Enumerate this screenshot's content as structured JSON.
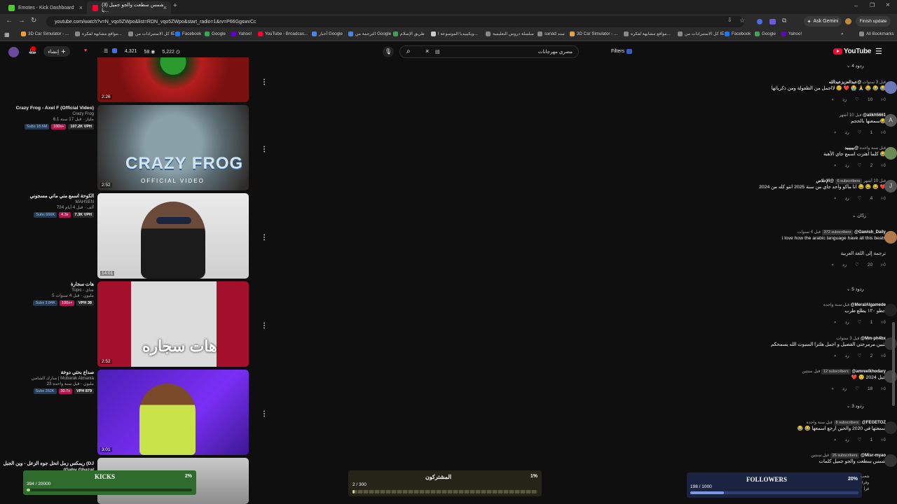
{
  "browser": {
    "tabs": [
      {
        "title": "Emotes - Kick Dashboard",
        "fav": "#52c934"
      },
      {
        "title": "(3) شمس سطعت والجو جميل يا...",
        "fav": "#ff0033"
      }
    ],
    "new_tab": "+",
    "url": "youtube.com/watch?v=N_vqo5ZWpo&list=RDN_vqo5ZWpo&start_radio=1&rv=P66GgswvCc",
    "ask_gemini": "Ask Gemini",
    "finish_update": "Finish update",
    "bookmarks": [
      {
        "label": "3D Car Simulator - ...",
        "c": "#f0a030"
      },
      {
        "label": "مواقع مشابهة لفكرة...",
        "c": "#888"
      },
      {
        "label": "كل الاستيرادات من IE",
        "c": "#888"
      },
      {
        "label": "Facebook",
        "c": "#1877f2"
      },
      {
        "label": "Google",
        "c": "#34a853"
      },
      {
        "label": "Yahoo!",
        "c": "#6001d2"
      },
      {
        "label": "YouTube - Broadcas...",
        "c": "#ff0033"
      },
      {
        "label": "أخبار Google",
        "c": "#4285f4"
      },
      {
        "label": "الترجمة من Google",
        "c": "#4285f4"
      },
      {
        "label": "طريق الإسلام",
        "c": "#3aa655"
      },
      {
        "label": "ويكيبيديا الموسوعة ا...",
        "c": "#ccc"
      },
      {
        "label": "سلسلة دروس التعليمية",
        "c": "#888"
      },
      {
        "label": "sanad سند",
        "c": "#888"
      },
      {
        "label": "3D Car Simulator - ...",
        "c": "#f0a030"
      },
      {
        "label": "مواقع مشابهة لفكرة...",
        "c": "#888"
      },
      {
        "label": "كل الاستيرادات من IE",
        "c": "#888"
      },
      {
        "label": "Facebook",
        "c": "#1877f2"
      },
      {
        "label": "Google",
        "c": "#34a853"
      },
      {
        "label": "Yahoo!",
        "c": "#6001d2"
      }
    ],
    "all_bookmarks": "All Bookmarks"
  },
  "masthead": {
    "create_label": "إنشاء",
    "stats": [
      "4,321",
      "58",
      "5,222"
    ],
    "search_query": "مصري مهرجانات",
    "filters_label": "Filters",
    "logo_text": "YouTube"
  },
  "playlist": [
    {
      "title": "",
      "channel": "",
      "meta": "",
      "duration": "2:26",
      "badges": [],
      "thumb": "v0"
    },
    {
      "title": "Crazy Frog - Axel F (Official Video)",
      "channel": "Crazy Frog",
      "meta": "6.1 مليار · قبل 17 سنة",
      "duration": "2:52",
      "badges": [
        "Subs 18.6M",
        "100x+",
        "107.2K VPH"
      ],
      "thumb": "v1"
    },
    {
      "title": "الكوحة اسمع مني ماني مسجوني",
      "channel": "MAHSEN",
      "meta": "724 ألف · قبل 4 أيام",
      "duration": "14:01",
      "badges": [
        "Subs 666K",
        "4.3x",
        "7.3K VPH"
      ],
      "thumb": "v2"
    },
    {
      "title": "هات سجارة",
      "channel": "Topic - شاي",
      "meta": "5 مليون · قبل 4 سنوات",
      "duration": "2:52",
      "badges": [
        "Subs 3.84K",
        "100x+",
        "VPH 38"
      ],
      "thumb": "v3"
    },
    {
      "title": "صداع بحتي دوخة",
      "channel": "مبارك الشامي | Mubarak Almania",
      "meta": "23 مليون · قبل سنة واحدة",
      "duration": "3:01",
      "badges": [
        "Subs 262K",
        "30.7x",
        "VPH 879"
      ],
      "thumb": "v4"
    },
    {
      "title": "ريمكس زمل انحل جوه الزعل - وين الجبل (DJ (Gaby Ghazal",
      "channel": "",
      "meta": "",
      "duration": "",
      "badges": [],
      "thumb": "v5"
    }
  ],
  "comments": [
    {
      "replies_top": "4 ردود"
    },
    {
      "author": "@عبدالعزيزعبدالله",
      "time": "قبل 3 سنوات",
      "sub": "",
      "text": "لااجمل من الطفولة ومن ذكرياتها 😢 ❤️ 😭 🙏 😂 😂 😂",
      "likes": "10",
      "reply": "رد",
      "avatar": "#6a78b8"
    },
    {
      "author": "@alikh5661",
      "time": "قبل 10 أشهر",
      "sub": "",
      "text": "سمعنها بالحجم😂",
      "likes": "1",
      "reply": "رد",
      "avatar": "#5a5a5a",
      "letter": "A"
    },
    {
      "author": "@بيبيبيد",
      "time": "قبل سنة واحدة",
      "sub": "",
      "text": "كلما اهتزت اسمع جاي الأهبة 😂",
      "likes": "2",
      "reply": "رد",
      "avatar": "#6b8a55"
    },
    {
      "author": "@الإخلاص",
      "time": "قبل 10 أشهر",
      "sub": "6 subscribers",
      "text": "انا ماكو واحد جاي من سنة 2025 انتو كله من 2024 😂 😂 😂 ❤️",
      "likes": "4",
      "reply": "رد",
      "avatar": "#555",
      "letter": "J"
    },
    {
      "replies_mid": "ردّان"
    },
    {
      "author": "@Gawish_Daily",
      "time": "قبل 4 سنوات",
      "sub": "372 subscribers",
      "text": "i love how the arabic language have all this beats",
      "translate": "ترجمة إلى اللغة العربية",
      "likes": "20",
      "reply": "رد",
      "avatar": "#b07a4a"
    },
    {
      "replies_5": "5 ردود"
    },
    {
      "author": "@MeralAlgamede",
      "time": "قبل سنة واحدة",
      "sub": "",
      "text": "حطو ١٢٠ يطلع طرب",
      "likes": "1",
      "reply": "رد",
      "avatar": "#222"
    },
    {
      "author": "@Mm-ph4bx",
      "time": "قبل 3 سنوات",
      "sub": "",
      "text": "بتبين مرمرجني الفضيل و اجمل هلترا السبوت الله يسمحكم",
      "likes": "2",
      "reply": "رد",
      "avatar": "#333"
    },
    {
      "author": "@amreelkhodary",
      "time": "قبل سنتين",
      "sub": "12 subscribers",
      "text": "❤️ 😊 جيل 2024",
      "likes": "18",
      "reply": "رد",
      "avatar": "#444"
    },
    {
      "replies_3": "3 ردود"
    },
    {
      "author": "@FEGETOZ",
      "time": "قبل سنة واحدة",
      "sub": "8 subscribers",
      "text": "😂 😂 سمعتها في 2020 والحين ارجع اسمعها",
      "likes": "1",
      "reply": "رد",
      "avatar": "#2a2a2a"
    },
    {
      "author": "@Misr-myao",
      "time": "قبل سنتين",
      "sub": "26 subscribers",
      "text": "شمس سطعت والجو جميل كلمات",
      "likes": "",
      "reply": "",
      "avatar": "#333"
    }
  ],
  "overlays": {
    "kicks": {
      "label": "KICKS",
      "pct": "2%",
      "count": "394 / 20000",
      "value": 0.02
    },
    "subs": {
      "label": "المشتركون",
      "pct": "1%",
      "count": "2 / 300",
      "value": 0.01
    },
    "followers": {
      "label": "FOLLOWERS",
      "pct": "20%",
      "count": "198 / 1000",
      "value": 0.2
    }
  },
  "misc_right": {
    "share": "شعب",
    "lines": [
      "وقرا",
      "قرأ"
    ]
  }
}
